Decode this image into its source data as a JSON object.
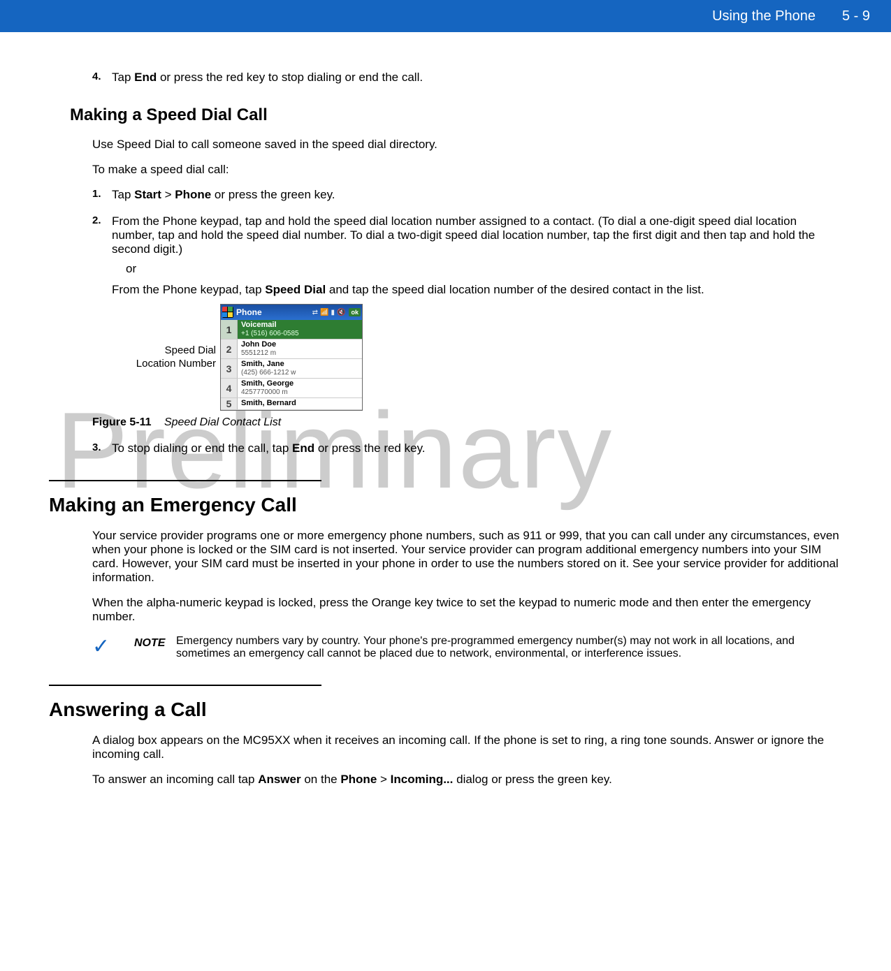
{
  "header": {
    "chapter_title": "Using the Phone",
    "page_num": "5 - 9"
  },
  "watermark": "Preliminary",
  "step4": {
    "num": "4.",
    "pre": "Tap ",
    "bold": "End",
    "post": " or press the red key to stop dialing or end the call."
  },
  "speed_dial": {
    "heading": "Making a Speed Dial Call",
    "intro": "Use Speed Dial to call someone saved in the speed dial directory.",
    "lead": "To make a speed dial call:",
    "s1": {
      "num": "1.",
      "pre": "Tap ",
      "b1": "Start",
      "gt": " > ",
      "b2": "Phone",
      "post": " or press the green key."
    },
    "s2": {
      "num": "2.",
      "text": "From the Phone keypad, tap and hold the speed dial location number assigned to a contact. (To dial a one-digit speed dial location number, tap and hold the speed dial number. To dial a two-digit speed dial location number, tap the first digit and then tap and hold the second digit.)",
      "or": "or",
      "alt_pre": "From the Phone keypad, tap ",
      "alt_bold": "Speed Dial",
      "alt_post": " and tap the speed dial location number of the desired contact in the list."
    },
    "fig_side_label_l1": "Speed Dial",
    "fig_side_label_l2": "Location Number",
    "fig_caption_num": "Figure 5-11",
    "fig_caption_text": "Speed Dial Contact List",
    "s3": {
      "num": "3.",
      "pre": "To stop dialing or end the call, tap ",
      "bold": "End",
      "post": " or press the red key."
    }
  },
  "mock": {
    "title": "Phone",
    "ok": "ok",
    "rows": [
      {
        "n": "1",
        "name": "Voicemail",
        "sub": "+1 (516) 606-0585"
      },
      {
        "n": "2",
        "name": "John Doe",
        "sub": "5551212 m"
      },
      {
        "n": "3",
        "name": "Smith, Jane",
        "sub": "(425) 666-1212 w"
      },
      {
        "n": "4",
        "name": "Smith, George",
        "sub": "4257770000 m"
      },
      {
        "n": "5",
        "name": "Smith, Bernard",
        "sub": ""
      }
    ]
  },
  "emergency": {
    "heading": "Making an Emergency Call",
    "p1": "Your service provider programs one or more emergency phone numbers, such as 911 or 999, that you can call under any circumstances, even when your phone is locked or the SIM card is not inserted. Your service provider can program additional emergency numbers into your SIM card. However, your SIM card must be inserted in your phone in order to use the numbers stored on it. See your service provider for additional information.",
    "p2": "When the alpha-numeric keypad is locked, press the Orange key twice to set the keypad to numeric mode and then enter the emergency number.",
    "note_label": "NOTE",
    "note_text": "Emergency numbers vary by country. Your phone's pre-programmed emergency number(s) may not work in all locations, and sometimes an emergency call cannot be placed due to network, environmental, or interference issues."
  },
  "answering": {
    "heading": "Answering a Call",
    "p1": "A dialog box appears on the MC95XX when it receives an incoming call. If the phone is set to ring, a ring tone sounds. Answer or ignore the incoming call.",
    "p2_pre": "To answer an incoming call tap ",
    "p2_b1": "Answer",
    "p2_mid1": " on the ",
    "p2_b2": "Phone",
    "p2_gt": " > ",
    "p2_b3": "Incoming...",
    "p2_post": " dialog or press the green key."
  }
}
